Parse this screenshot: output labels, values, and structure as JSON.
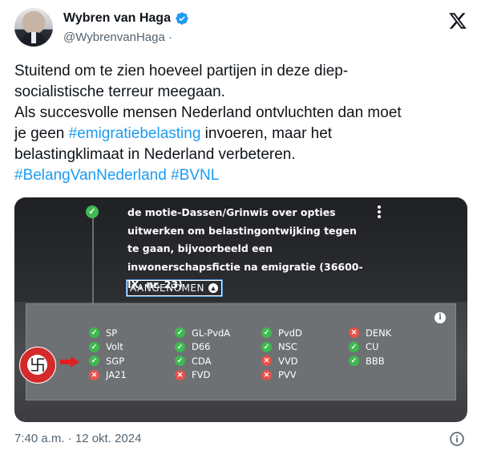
{
  "author": {
    "display_name": "Wybren van Haga",
    "handle": "@WybrenvanHaga",
    "handle_suffix": "·",
    "avatar_icon": "profile-photo",
    "verified": true
  },
  "platform_logo": "X",
  "tweet": {
    "line1": "Stuitend om te zien hoeveel partijen in deze diep-",
    "line2": "socialistische terreur meegaan.",
    "line3": "Als succesvolle mensen Nederland ontvluchten dan moet",
    "line4_pre": "je geen ",
    "line4_link": "#emigratiebelasting",
    "line4_post": " invoeren, maar het",
    "line5": "belastingklimaat in Nederland verbeteren.",
    "hashtag1": "#BelangVanNederland",
    "hashtag2": "#BVNL"
  },
  "media": {
    "motion_text": "de motie-Dassen/Grinwis over opties uitwerken om belastingontwijking tegen te gaan, bijvoorbeeld een inwonerschapsfictie na emigratie (36600-IX, nr. 23)",
    "status": "AANGENOMEN",
    "columns": [
      [
        {
          "party": "SP",
          "vote": "voor"
        },
        {
          "party": "Volt",
          "vote": "voor"
        },
        {
          "party": "SGP",
          "vote": "voor"
        },
        {
          "party": "JA21",
          "vote": "tegen"
        }
      ],
      [
        {
          "party": "GL-PvdA",
          "vote": "voor"
        },
        {
          "party": "D66",
          "vote": "voor"
        },
        {
          "party": "CDA",
          "vote": "voor"
        },
        {
          "party": "FVD",
          "vote": "tegen"
        }
      ],
      [
        {
          "party": "PvdD",
          "vote": "voor"
        },
        {
          "party": "NSC",
          "vote": "voor"
        },
        {
          "party": "VVD",
          "vote": "tegen"
        },
        {
          "party": "PVV",
          "vote": "tegen"
        }
      ],
      [
        {
          "party": "DENK",
          "vote": "tegen"
        },
        {
          "party": "CU",
          "vote": "voor"
        },
        {
          "party": "BBB",
          "vote": "voor"
        }
      ]
    ],
    "colors": {
      "voor": "#3fb950",
      "tegen": "#e5534b",
      "arrow": "#e02020"
    }
  },
  "footer": {
    "timestamp": "7:40 a.m. · 12 okt. 2024"
  }
}
